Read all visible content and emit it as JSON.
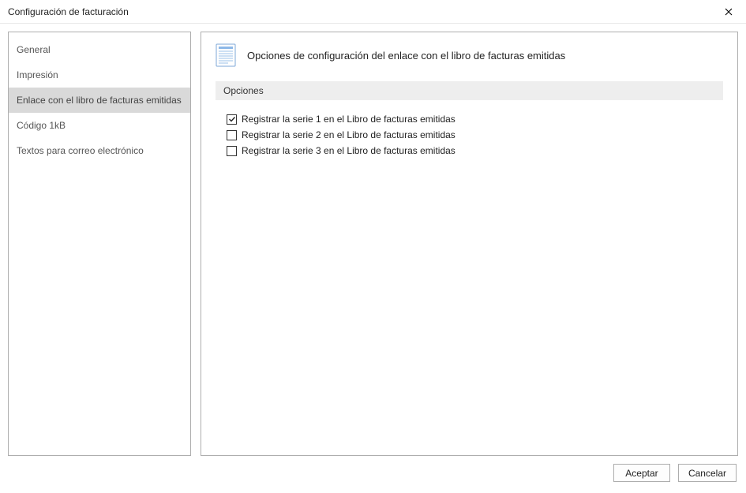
{
  "window": {
    "title": "Configuración de facturación"
  },
  "sidebar": {
    "items": [
      {
        "label": "General",
        "selected": false
      },
      {
        "label": "Impresión",
        "selected": false
      },
      {
        "label": "Enlace con el libro de facturas emitidas",
        "selected": true
      },
      {
        "label": "Código 1kB",
        "selected": false
      },
      {
        "label": "Textos para correo electrónico",
        "selected": false
      }
    ]
  },
  "content": {
    "title": "Opciones de configuración del enlace con el libro de facturas emitidas",
    "section_header": "Opciones",
    "options": [
      {
        "label": "Registrar la serie 1 en el Libro de facturas emitidas",
        "checked": true
      },
      {
        "label": "Registrar la serie 2 en el Libro de facturas emitidas",
        "checked": false
      },
      {
        "label": "Registrar la serie 3 en el Libro de facturas emitidas",
        "checked": false
      }
    ]
  },
  "footer": {
    "accept": "Aceptar",
    "cancel": "Cancelar"
  }
}
